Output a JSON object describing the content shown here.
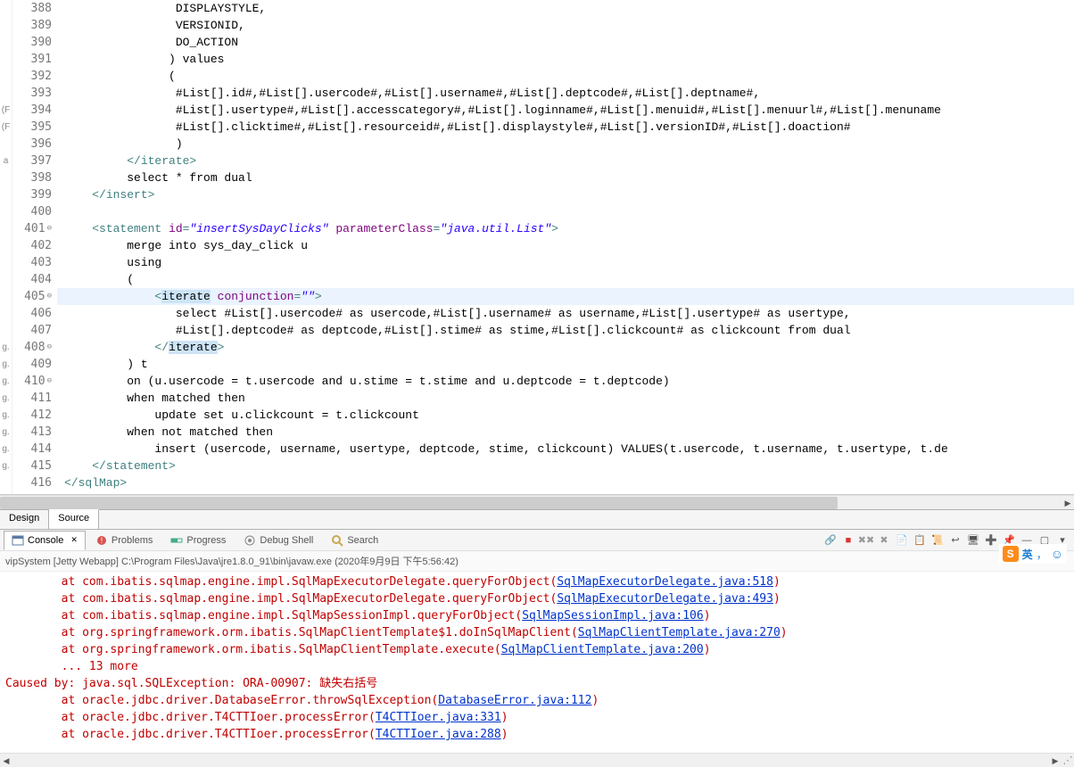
{
  "lines": [
    {
      "n": 388,
      "seg": [
        {
          "c": "txt",
          "t": "                DISPLAYSTYLE,"
        }
      ]
    },
    {
      "n": 389,
      "seg": [
        {
          "c": "txt",
          "t": "                VERSIONID,"
        }
      ]
    },
    {
      "n": 390,
      "seg": [
        {
          "c": "txt",
          "t": "                DO_ACTION"
        }
      ]
    },
    {
      "n": 391,
      "seg": [
        {
          "c": "txt",
          "t": "               ) values"
        }
      ]
    },
    {
      "n": 392,
      "seg": [
        {
          "c": "txt",
          "t": "               ("
        }
      ]
    },
    {
      "n": 393,
      "seg": [
        {
          "c": "txt",
          "t": "                #List[].id#,#List[].usercode#,#List[].username#,#List[].deptcode#,#List[].deptname#,"
        }
      ]
    },
    {
      "n": 394,
      "seg": [
        {
          "c": "txt",
          "t": "                #List[].usertype#,#List[].accesscategory#,#List[].loginname#,#List[].menuid#,#List[].menuurl#,#List[].menuname"
        }
      ]
    },
    {
      "n": 395,
      "seg": [
        {
          "c": "txt",
          "t": "                #List[].clicktime#,#List[].resourceid#,#List[].displaystyle#,#List[].versionID#,#List[].doaction#"
        }
      ]
    },
    {
      "n": 396,
      "seg": [
        {
          "c": "txt",
          "t": "                )"
        }
      ]
    },
    {
      "n": 397,
      "seg": [
        {
          "c": "txt",
          "t": "         "
        },
        {
          "c": "tag",
          "t": "</iterate>"
        }
      ]
    },
    {
      "n": 398,
      "seg": [
        {
          "c": "txt",
          "t": "         select * from dual"
        }
      ]
    },
    {
      "n": 399,
      "seg": [
        {
          "c": "txt",
          "t": "    "
        },
        {
          "c": "tag",
          "t": "</insert>"
        }
      ]
    },
    {
      "n": 400,
      "seg": [
        {
          "c": "txt",
          "t": ""
        }
      ]
    },
    {
      "n": 401,
      "fold": "⊖",
      "seg": [
        {
          "c": "txt",
          "t": "    "
        },
        {
          "c": "tag",
          "t": "<statement"
        },
        {
          "c": "txt",
          "t": " "
        },
        {
          "c": "attr",
          "t": "id"
        },
        {
          "c": "tag",
          "t": "="
        },
        {
          "c": "str",
          "t": "\"insertSysDayClicks\""
        },
        {
          "c": "txt",
          "t": " "
        },
        {
          "c": "attr",
          "t": "parameterClass"
        },
        {
          "c": "tag",
          "t": "="
        },
        {
          "c": "str",
          "t": "\"java.util.List\""
        },
        {
          "c": "tag",
          "t": ">"
        }
      ]
    },
    {
      "n": 402,
      "seg": [
        {
          "c": "txt",
          "t": "         merge into sys_day_click u"
        }
      ]
    },
    {
      "n": 403,
      "seg": [
        {
          "c": "txt",
          "t": "         using"
        }
      ]
    },
    {
      "n": 404,
      "seg": [
        {
          "c": "txt",
          "t": "         ("
        }
      ]
    },
    {
      "n": 405,
      "fold": "⊖",
      "hl": true,
      "seg": [
        {
          "c": "txt",
          "t": "             "
        },
        {
          "c": "tag",
          "t": "<"
        },
        {
          "c": "sel",
          "t": "iterate"
        },
        {
          "c": "txt",
          "t": " "
        },
        {
          "c": "attr",
          "t": "conjunction"
        },
        {
          "c": "tag",
          "t": "="
        },
        {
          "c": "str",
          "t": "\"\""
        },
        {
          "c": "tag",
          "t": ">"
        }
      ]
    },
    {
      "n": 406,
      "seg": [
        {
          "c": "txt",
          "t": "                select #List[].usercode# as usercode,#List[].username# as username,#List[].usertype# as usertype,"
        }
      ]
    },
    {
      "n": 407,
      "seg": [
        {
          "c": "txt",
          "t": "                #List[].deptcode# as deptcode,#List[].stime# as stime,#List[].clickcount# as clickcount from dual"
        }
      ]
    },
    {
      "n": 408,
      "fold": "⊖",
      "seg": [
        {
          "c": "txt",
          "t": "             "
        },
        {
          "c": "tag",
          "t": "</"
        },
        {
          "c": "sel",
          "t": "iterate"
        },
        {
          "c": "tag",
          "t": ">"
        }
      ]
    },
    {
      "n": 409,
      "seg": [
        {
          "c": "txt",
          "t": "         ) t"
        }
      ]
    },
    {
      "n": 410,
      "fold": "⊖",
      "seg": [
        {
          "c": "txt",
          "t": "         on (u.usercode = t.usercode and u.stime = t.stime and u.deptcode = t.deptcode)"
        }
      ]
    },
    {
      "n": 411,
      "seg": [
        {
          "c": "txt",
          "t": "         when matched then"
        }
      ]
    },
    {
      "n": 412,
      "seg": [
        {
          "c": "txt",
          "t": "             update set u.clickcount = t.clickcount"
        }
      ]
    },
    {
      "n": 413,
      "seg": [
        {
          "c": "txt",
          "t": "         when not matched then"
        }
      ]
    },
    {
      "n": 414,
      "seg": [
        {
          "c": "txt",
          "t": "             insert (usercode, username, usertype, deptcode, stime, clickcount) VALUES(t.usercode, t.username, t.usertype, t.de"
        }
      ]
    },
    {
      "n": 415,
      "seg": [
        {
          "c": "txt",
          "t": "    "
        },
        {
          "c": "tag",
          "t": "</statement>"
        }
      ]
    },
    {
      "n": 416,
      "seg": [
        {
          "c": "tag",
          "t": "</sqlMap>"
        }
      ]
    }
  ],
  "leftEdge": [
    "",
    "",
    "",
    "",
    "",
    "",
    "(F",
    "(F",
    "",
    "a",
    "",
    "",
    "",
    "",
    "",
    "",
    "",
    "",
    "",
    "",
    "g.",
    "g.",
    "g.",
    "g.",
    "g.",
    "g.",
    "g.",
    "g.",
    ""
  ],
  "editorTabs": {
    "design": "Design",
    "source": "Source",
    "active": "source"
  },
  "bottomTabs": [
    {
      "id": "console",
      "label": "Console",
      "icon": "console",
      "active": true,
      "close": true
    },
    {
      "id": "problems",
      "label": "Problems",
      "icon": "problems"
    },
    {
      "id": "progress",
      "label": "Progress",
      "icon": "progress"
    },
    {
      "id": "debug",
      "label": "Debug Shell",
      "icon": "debug"
    },
    {
      "id": "search",
      "label": "Search",
      "icon": "search"
    }
  ],
  "toolbarIcons": [
    "link",
    "stop",
    "remove-all",
    "remove",
    "doc-a",
    "doc-b",
    "scroll-lock",
    "wrap",
    "console-view",
    "new-console",
    "pin",
    "min",
    "max",
    "dropdown"
  ],
  "launch": "vipSystem [Jetty Webapp] C:\\Program Files\\Java\\jre1.8.0_91\\bin\\javaw.exe (2020年9月9日 下午5:56:42)",
  "consoleLines": [
    {
      "pre": "        at com.ibatis.sqlmap.engine.impl.SqlMapExecutorDelegate.queryForObject(",
      "link": "SqlMapExecutorDelegate.java:518",
      "post": ")"
    },
    {
      "pre": "        at com.ibatis.sqlmap.engine.impl.SqlMapExecutorDelegate.queryForObject(",
      "link": "SqlMapExecutorDelegate.java:493",
      "post": ")"
    },
    {
      "pre": "        at com.ibatis.sqlmap.engine.impl.SqlMapSessionImpl.queryForObject(",
      "link": "SqlMapSessionImpl.java:106",
      "post": ")"
    },
    {
      "pre": "        at org.springframework.orm.ibatis.SqlMapClientTemplate$1.doInSqlMapClient(",
      "link": "SqlMapClientTemplate.java:270",
      "post": ")"
    },
    {
      "pre": "        at org.springframework.orm.ibatis.SqlMapClientTemplate.execute(",
      "link": "SqlMapClientTemplate.java:200",
      "post": ")"
    },
    {
      "pre": "        ... 13 more",
      "link": "",
      "post": ""
    },
    {
      "pre": "Caused by: java.sql.SQLException: ORA-00907: 缺失右括号",
      "link": "",
      "post": ""
    },
    {
      "pre": "",
      "link": "",
      "post": ""
    },
    {
      "pre": "        at oracle.jdbc.driver.DatabaseError.throwSqlException(",
      "link": "DatabaseError.java:112",
      "post": ")"
    },
    {
      "pre": "        at oracle.jdbc.driver.T4CTTIoer.processError(",
      "link": "T4CTTIoer.java:331",
      "post": ")"
    },
    {
      "pre": "        at oracle.jdbc.driver.T4CTTIoer.processError(",
      "link": "T4CTTIoer.java:288",
      "post": ")"
    }
  ],
  "ime": {
    "logo": "S",
    "lang": "英",
    "extra": "，"
  }
}
